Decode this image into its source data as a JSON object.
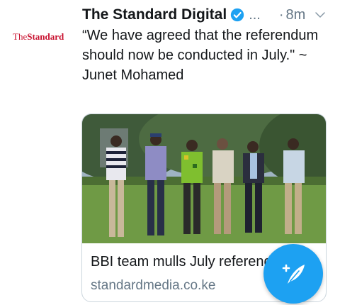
{
  "tweet": {
    "avatar_logo": {
      "part1": "The",
      "part2": "Standard"
    },
    "author_name": "The Standard Digital",
    "handle_ellipsis": "...",
    "time_dot": "·",
    "time": "8m",
    "text": "“We have agreed that the referendum should now be conducted in July.\" ~ Junet Mohamed"
  },
  "card": {
    "title": "BBI team mulls July referendum",
    "domain": "standardmedia.co.ke"
  },
  "icons": {
    "verified": "verified-badge-icon",
    "menu": "chevron-down-icon",
    "compose": "compose-tweet-icon"
  },
  "colors": {
    "accent": "#1da1f2",
    "secondary_text": "#657786",
    "logo_red": "#c8102e"
  }
}
